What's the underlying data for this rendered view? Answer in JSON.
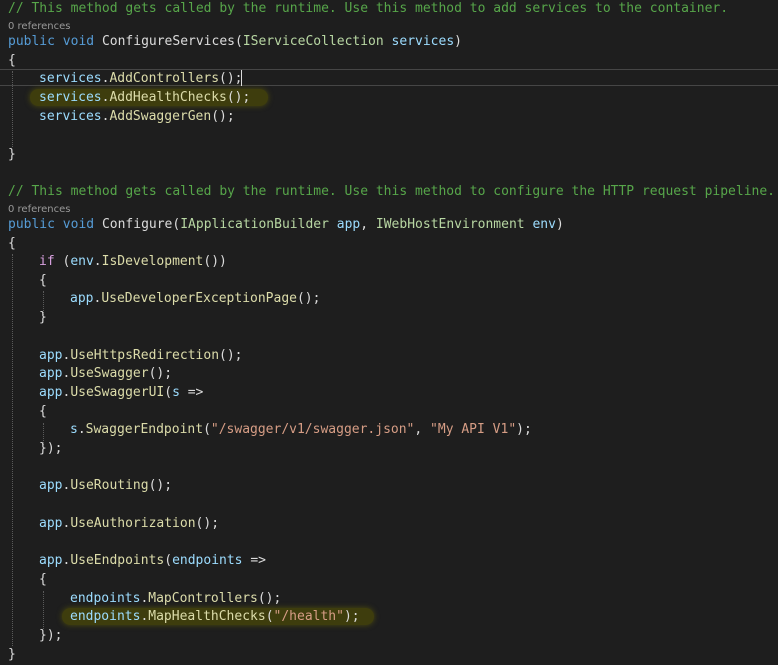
{
  "configure_services": {
    "comment": "// This method gets called by the runtime. Use this method to add services to the container.",
    "references": "0 references",
    "signature": {
      "public": "public",
      "void": "void",
      "name": "ConfigureServices",
      "open": "(",
      "param_type": "IServiceCollection",
      "param_name": "services",
      "close": ")"
    },
    "lines": [
      {
        "target": "services",
        "dot": ".",
        "method": "AddControllers",
        "tail": "();"
      },
      {
        "target": "services",
        "dot": ".",
        "method": "AddHealthChecks",
        "tail": "();"
      },
      {
        "target": "services",
        "dot": ".",
        "method": "AddSwaggerGen",
        "tail": "();"
      }
    ]
  },
  "configure": {
    "comment": "// This method gets called by the runtime. Use this method to configure the HTTP request pipeline.",
    "references": "0 references",
    "signature": {
      "public": "public",
      "void": "void",
      "name": "Configure",
      "open": "(",
      "type1": "IApplicationBuilder",
      "param1": "app",
      "comma": ", ",
      "type2": "IWebHostEnvironment",
      "param2": "env",
      "close": ")"
    },
    "if_keyword": "if",
    "if_open": " (",
    "if_target": "env",
    "if_method": "IsDevelopment",
    "if_close": "())",
    "dev_line": {
      "target": "app",
      "method": "UseDeveloperExceptionPage",
      "tail": "();"
    },
    "https": {
      "target": "app",
      "method": "UseHttpsRedirection",
      "tail": "();"
    },
    "swagger": {
      "target": "app",
      "method": "UseSwagger",
      "tail": "();"
    },
    "swagger_ui": {
      "target": "app",
      "method": "UseSwaggerUI",
      "open": "(",
      "lambda_param": "s",
      "arrow": " =>"
    },
    "endpoint_line": {
      "target": "s",
      "method": "SwaggerEndpoint",
      "open": "(",
      "arg1": "\"/swagger/v1/swagger.json\"",
      "comma": ", ",
      "arg2": "\"My API V1\"",
      "close": ");"
    },
    "routing": {
      "target": "app",
      "method": "UseRouting",
      "tail": "();"
    },
    "authorization": {
      "target": "app",
      "method": "UseAuthorization",
      "tail": "();"
    },
    "use_endpoints": {
      "target": "app",
      "method": "UseEndpoints",
      "open": "(",
      "lambda_param": "endpoints",
      "arrow": " =>"
    },
    "map_controllers": {
      "target": "endpoints",
      "method": "MapControllers",
      "tail": "();"
    },
    "map_health": {
      "target": "endpoints",
      "method": "MapHealthChecks",
      "open": "(",
      "arg": "\"/health\"",
      "close": ");"
    }
  },
  "braces": {
    "open": "{",
    "close": "}",
    "lambda_close": "});"
  }
}
